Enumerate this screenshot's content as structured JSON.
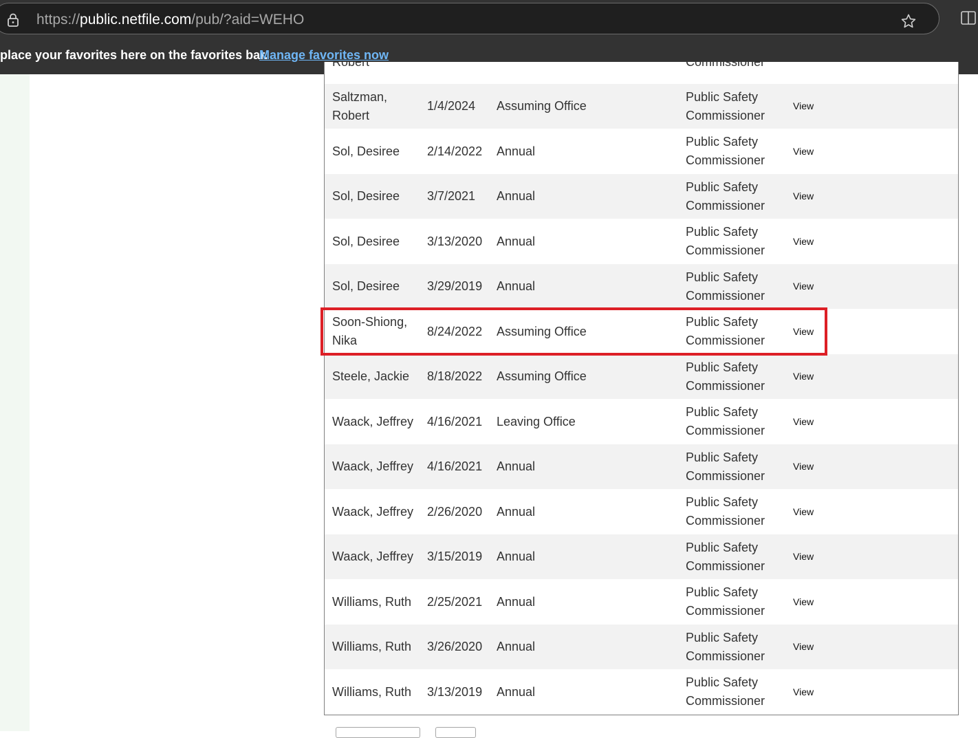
{
  "browser": {
    "url_prefix": "https://",
    "url_host": "public.netfile.com",
    "url_path": "/pub/?aid=WEHO",
    "favorites_text": "place your favorites here on the favorites bar.",
    "favorites_link": "Manage favorites now"
  },
  "table": {
    "partial_top_row": {
      "name": "Robert",
      "position": "Commissioner"
    },
    "rows": [
      {
        "name": "Saltzman, Robert",
        "date": "1/4/2024",
        "type": "Assuming Office",
        "position": "Public Safety Commissioner",
        "action": "View"
      },
      {
        "name": "Sol, Desiree",
        "date": "2/14/2022",
        "type": "Annual",
        "position": "Public Safety Commissioner",
        "action": "View"
      },
      {
        "name": "Sol, Desiree",
        "date": "3/7/2021",
        "type": "Annual",
        "position": "Public Safety Commissioner",
        "action": "View"
      },
      {
        "name": "Sol, Desiree",
        "date": "3/13/2020",
        "type": "Annual",
        "position": "Public Safety Commissioner",
        "action": "View"
      },
      {
        "name": "Sol, Desiree",
        "date": "3/29/2019",
        "type": "Annual",
        "position": "Public Safety Commissioner",
        "action": "View"
      },
      {
        "name": "Soon-Shiong, Nika",
        "date": "8/24/2022",
        "type": "Assuming Office",
        "position": "Public Safety Commissioner",
        "action": "View"
      },
      {
        "name": "Steele, Jackie",
        "date": "8/18/2022",
        "type": "Assuming Office",
        "position": "Public Safety Commissioner",
        "action": "View"
      },
      {
        "name": "Waack, Jeffrey",
        "date": "4/16/2021",
        "type": "Leaving Office",
        "position": "Public Safety Commissioner",
        "action": "View"
      },
      {
        "name": "Waack, Jeffrey",
        "date": "4/16/2021",
        "type": "Annual",
        "position": "Public Safety Commissioner",
        "action": "View"
      },
      {
        "name": "Waack, Jeffrey",
        "date": "2/26/2020",
        "type": "Annual",
        "position": "Public Safety Commissioner",
        "action": "View"
      },
      {
        "name": "Waack, Jeffrey",
        "date": "3/15/2019",
        "type": "Annual",
        "position": "Public Safety Commissioner",
        "action": "View"
      },
      {
        "name": "Williams, Ruth",
        "date": "2/25/2021",
        "type": "Annual",
        "position": "Public Safety Commissioner",
        "action": "View"
      },
      {
        "name": "Williams, Ruth",
        "date": "3/26/2020",
        "type": "Annual",
        "position": "Public Safety Commissioner",
        "action": "View"
      },
      {
        "name": "Williams, Ruth",
        "date": "3/13/2019",
        "type": "Annual",
        "position": "Public Safety Commissioner",
        "action": "View"
      }
    ]
  },
  "colors": {
    "highlight": "#dd1f26",
    "link": "#6fb6f5"
  }
}
